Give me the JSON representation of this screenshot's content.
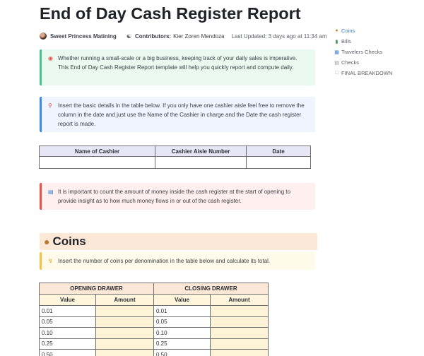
{
  "page": {
    "title": "End of Day Cash Register Report",
    "author": "Sweet Princess Matining",
    "contributors_label": "Contributors:",
    "contributors": "Kier Zoren Mendoza",
    "last_updated": "Last Updated: 3 days ago at 11:34 am"
  },
  "toc": [
    {
      "label": "Coins",
      "icon": "money-bag-icon",
      "active": true
    },
    {
      "label": "Bills",
      "icon": "banknote-icon",
      "active": false
    },
    {
      "label": "Travelers Checks",
      "icon": "card-icon",
      "active": false
    },
    {
      "label": "Checks",
      "icon": "receipt-icon",
      "active": false
    },
    {
      "label": "FINAL BREAKDOWN",
      "icon": "document-icon",
      "active": false
    }
  ],
  "callouts": {
    "intro": {
      "icon": "target-icon",
      "text": "Whether running a small-scale or a big business, keeping track of your daily sales is imperative. This End of Day Cash Register Report template will help you quickly report and compute daily."
    },
    "details": {
      "icon": "pin-icon",
      "text": "Insert the basic details in the table below. If you only have one cashier aisle feel free to remove the column in the date and just use the Name of the Cashier in charge and the Date the cash register report is made."
    },
    "count": {
      "icon": "chart-icon",
      "text": "It is important to count the amount of money inside the cash register at the start of opening to provide insight as to how much money flows in or out of the cash register."
    },
    "coins": {
      "icon": "lightning-icon",
      "text": "Insert the number of coins per denomination in the table below and calculate its total."
    }
  },
  "cashier_table": {
    "headers": [
      "Name of Cashier",
      "Cashier Aisle Number",
      "Date"
    ],
    "rows": [
      [
        "",
        "",
        ""
      ]
    ]
  },
  "coins_section": {
    "icon": "money-bag-icon",
    "title": "Coins"
  },
  "drawer_table": {
    "groups": [
      "OPENING DRAWER",
      "CLOSING DRAWER"
    ],
    "subheaders": [
      "Value",
      "Amount",
      "Value",
      "Amount"
    ],
    "rows": [
      [
        "0.01",
        "",
        "0.01",
        ""
      ],
      [
        "0.05",
        "",
        "0.05",
        ""
      ],
      [
        "0.10",
        "",
        "0.10",
        ""
      ],
      [
        "0.25",
        "",
        "0.25",
        ""
      ],
      [
        "0.50",
        "",
        "0.50",
        ""
      ]
    ]
  }
}
